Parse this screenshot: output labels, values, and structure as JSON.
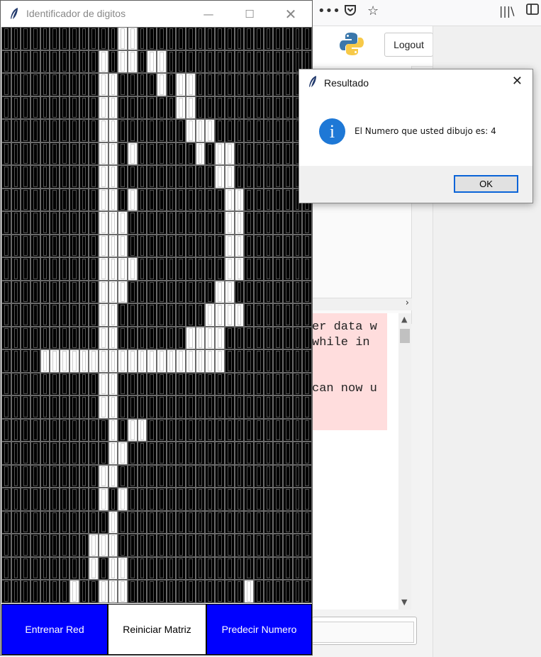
{
  "browser": {
    "toolbar_icons": [
      "more-icon",
      "pocket-icon",
      "bookmark-star-icon",
      "library-icon",
      "sidebar-icon"
    ],
    "logout_label": "Logout",
    "chat_lines": [
      "er data w",
      "while in",
      "",
      "can now u"
    ]
  },
  "main_window": {
    "title": "Identificador de digitos",
    "grid": {
      "cols": 32,
      "rows": 25,
      "cells": [
        "............##..................",
        "..........#.##.##...............",
        "..........##....#.##............",
        "..........##......##............",
        "..........##.......###..........",
        "..........##.#......#.##........",
        "..........##..........##........",
        "..........##.#.........##.......",
        "..........###..........##.......",
        "..........###..........##.......",
        "..........####.........##.......",
        "..........###.........##........",
        "..........##.........####.......",
        "..........##.......####.........",
        "....###################.........",
        "..........##....................",
        "..........##....................",
        "...........#.##.................",
        "...........##...................",
        "..........##....................",
        "..........#.#...................",
        "...........#....................",
        ".........###....................",
        ".........#.##...................",
        ".......#..###............#......"
      ]
    },
    "buttons": [
      {
        "label": "Entrenar Red",
        "bg": "#0000ff",
        "fg": "#ffffff"
      },
      {
        "label": "Reiniciar Matriz",
        "bg": "#ffffff",
        "fg": "#000000"
      },
      {
        "label": "Predecir Numero",
        "bg": "#0000ff",
        "fg": "#ffffff"
      }
    ]
  },
  "dialog": {
    "title": "Resultado",
    "message": "El Numero que usted dibujo es: 4",
    "ok_label": "OK",
    "icon": "info-icon",
    "accent": "#1e78d6"
  }
}
